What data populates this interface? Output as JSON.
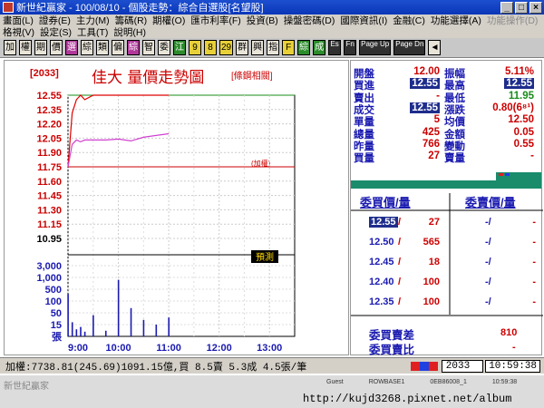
{
  "window": {
    "title": "新世紀贏家 - 100/08/10 - 個股走勢：綜合自選股[名望股]"
  },
  "menu": {
    "row1": [
      "畫面(L)",
      "證券(E)",
      "主力(M)",
      "籌碼(R)",
      "期權(O)",
      "匯市利率(F)",
      "投資(B)",
      "操盤密碼(D)",
      "國際資訊(I)",
      "金融(C)",
      "功能選擇(A)"
    ],
    "row1_disabled": "功能操作(D)",
    "row2": [
      "格視(V)",
      "設定(S)",
      "工具(T)",
      "說明(H)"
    ]
  },
  "toolbar": [
    "加",
    "權",
    "期",
    "價",
    "選",
    "綜",
    "類",
    "偏",
    "綜",
    "智",
    "委",
    "江",
    "9",
    "8",
    "29",
    "群",
    "興",
    "指",
    "F",
    "綜",
    "成",
    "Es",
    "Fn",
    "Page Up",
    "Page Dn",
    "◄"
  ],
  "chart": {
    "stock_code": "[2033]",
    "title": "佳大 量價走勢圖",
    "sub_link": "[條鋼相關]",
    "side_label": "(加權)",
    "tag": "預測",
    "price_labels": [
      "12.55",
      "12.35",
      "12.20",
      "12.05",
      "11.90",
      "11.75",
      "11.60",
      "11.45",
      "11.30",
      "11.15",
      "10.95"
    ],
    "volume_labels": [
      "3,000",
      "1,000",
      "500",
      "100",
      "50",
      "15",
      "張"
    ],
    "time_labels": [
      "9:00",
      "10:00",
      "11:00",
      "12:00",
      "13:00"
    ]
  },
  "chart_data": {
    "type": "line",
    "title": "佳大 量價走勢圖",
    "x": [
      "9:00",
      "9:05",
      "9:10",
      "9:15",
      "9:20",
      "9:30",
      "9:45",
      "10:00",
      "10:15",
      "10:30",
      "10:45",
      "11:00"
    ],
    "series": [
      {
        "values": [
          11.75,
          12.35,
          12.5,
          12.55,
          12.5,
          12.55,
          12.55,
          12.55,
          12.55,
          12.55,
          12.55,
          12.55
        ]
      },
      {
        "values": [
          11.75,
          12.0,
          12.05,
          12.03,
          12.05,
          12.05,
          12.05,
          12.06,
          12.04,
          12.08,
          12.1,
          12.12
        ]
      }
    ],
    "volume": [
      90,
      30,
      15,
      20,
      10,
      45,
      12,
      120,
      60,
      35,
      25,
      40
    ],
    "ylim": [
      10.95,
      12.55
    ],
    "xlim": [
      "9:00",
      "13:30"
    ]
  },
  "quote": {
    "rows": [
      {
        "label": "開盤",
        "value": "12.00",
        "label2": "振幅",
        "value2": "5.11%"
      },
      {
        "label": "買進",
        "value": "12.55",
        "label2": "最高",
        "value2": "12.55"
      },
      {
        "label": "賣出",
        "value": "-",
        "label2": "最低",
        "value2": "11.95"
      },
      {
        "label": "成交",
        "value": "12.55",
        "label2": "漲跌",
        "value2": "0.80(6⁸¹)"
      },
      {
        "label": "單量",
        "value": "5",
        "label2": "均價",
        "value2": "12.50"
      },
      {
        "label": "總量",
        "value": "425",
        "label2": "金額",
        "value2": "0.05"
      },
      {
        "label": "昨量",
        "value": "766",
        "label2": "變動",
        "value2": "0.55"
      },
      {
        "label": "買量",
        "value": "27",
        "label2": "賣量",
        "value2": "-"
      }
    ]
  },
  "orderbook": {
    "bid_header": "委買價/量",
    "ask_header": "委賣價/量",
    "bids": [
      {
        "price": "12.55",
        "qty": "27"
      },
      {
        "price": "12.50",
        "qty": "565"
      },
      {
        "price": "12.45",
        "qty": "18"
      },
      {
        "price": "12.40",
        "qty": "100"
      },
      {
        "price": "12.35",
        "qty": "100"
      }
    ],
    "asks": [
      "-/",
      "-/",
      "-/",
      "-/",
      "-/"
    ],
    "diff_label": "委買賣差",
    "diff_value": "810",
    "ratio_label": "委買賣比",
    "ratio_value": "-"
  },
  "status": {
    "index_text": "加權:7738.81(245.69)1091.15億,買 8.5賣 5.3成 4.5張/筆",
    "code": "2033",
    "time": "10:59:38"
  },
  "footer": {
    "app": "新世紀贏家",
    "user": "Guest",
    "rows": "ROWBASE1",
    "id": "0EB86008_1",
    "time": "10:59:38",
    "url": "http://kujd3268.pixnet.net/album"
  }
}
